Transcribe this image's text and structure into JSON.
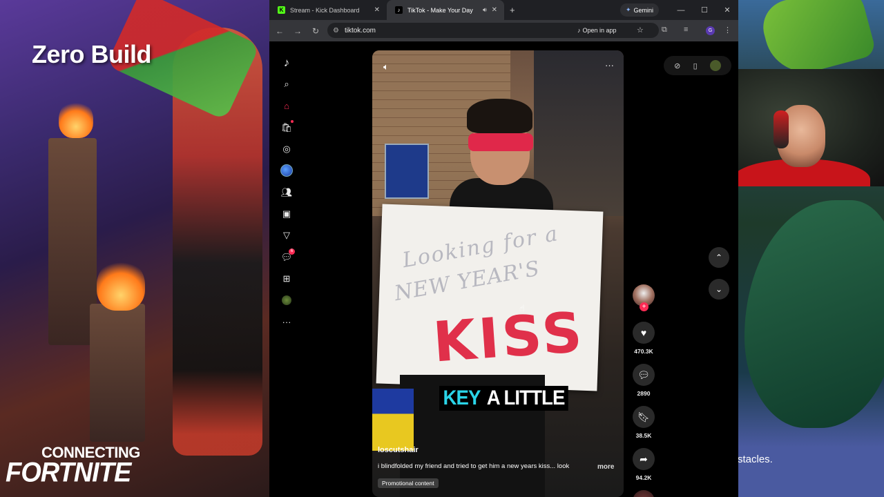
{
  "overlay": {
    "mode_title": "Zero Build",
    "connecting": "CONNECTING",
    "game_title": "FORTNITE",
    "right_caption": "stacles."
  },
  "browser": {
    "tabs": [
      {
        "title": "Stream - Kick Dashboard",
        "favicon": "kick-logo",
        "color": "#53fc18"
      },
      {
        "title": "TikTok - Make Your Day",
        "favicon": "tiktok-logo",
        "active": true
      }
    ],
    "gemini_label": "Gemini",
    "url": "tiktok.com",
    "open_in_app": "Open in app",
    "profile_initial": "G"
  },
  "tiktok": {
    "sidenav": [
      {
        "name": "tiktok-logo-icon"
      },
      {
        "name": "search-icon"
      },
      {
        "name": "home-icon",
        "active": true
      },
      {
        "name": "shop-icon"
      },
      {
        "name": "explore-icon"
      },
      {
        "name": "globe-icon"
      },
      {
        "name": "friends-icon"
      },
      {
        "name": "live-icon"
      },
      {
        "name": "messages-icon"
      },
      {
        "name": "inbox-icon",
        "badge": "6"
      },
      {
        "name": "upload-icon"
      },
      {
        "name": "profile-avatar-icon"
      },
      {
        "name": "more-icon"
      }
    ],
    "inbox_badge": "6",
    "video": {
      "caption_highlight": "KEY",
      "caption_rest": "A LITTLE",
      "sign_line1": "Looking for a",
      "sign_line2": "NEW YEAR'S",
      "sign_kiss": "KISS",
      "username": "loscutshair",
      "description": "i blindfolded my friend and tried to get him a new years kiss... look",
      "more_label": "more",
      "promo_label": "Promotional content"
    },
    "actions": {
      "likes": "470.3K",
      "comments": "2890",
      "saves": "38.5K",
      "shares": "94.2K"
    }
  }
}
